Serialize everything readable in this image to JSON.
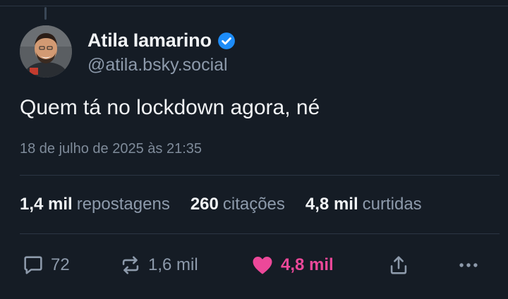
{
  "post": {
    "author": {
      "display_name": "Atila Iamarino",
      "handle": "@atila.bsky.social",
      "verified": true,
      "avatar_icon": "avatar-photo"
    },
    "text": "Quem tá no lockdown agora, né",
    "timestamp": "18 de julho de 2025 às 21:35",
    "stats": [
      {
        "value": "1,4 mil",
        "label": "repostagens"
      },
      {
        "value": "260",
        "label": "citações"
      },
      {
        "value": "4,8 mil",
        "label": "curtidas"
      }
    ],
    "actions": {
      "reply": {
        "icon": "reply-icon",
        "count": "72"
      },
      "repost": {
        "icon": "repost-icon",
        "count": "1,6 mil"
      },
      "like": {
        "icon": "heart-icon",
        "count": "4,8 mil",
        "active": true
      },
      "share": {
        "icon": "share-icon"
      },
      "more": {
        "icon": "more-icon"
      }
    }
  },
  "colors": {
    "background": "#151c25",
    "text": "#f1f3f5",
    "muted": "#8d9aab",
    "verified": "#1d8cf8",
    "like": "#ec4899"
  }
}
